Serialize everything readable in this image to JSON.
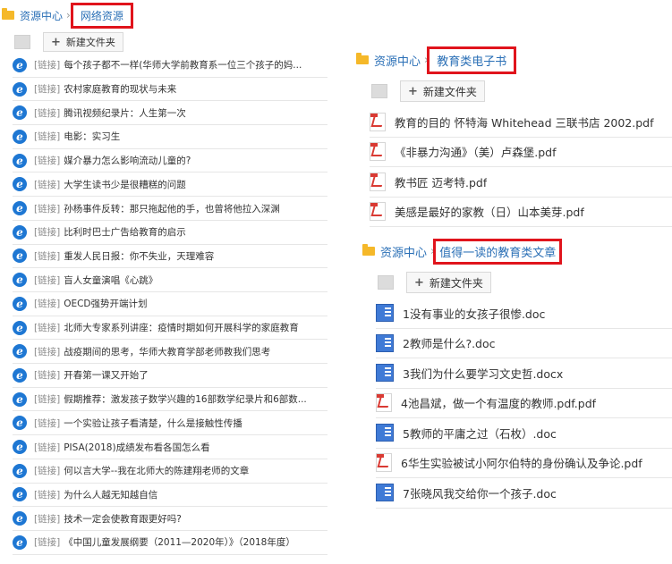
{
  "left": {
    "breadcrumb": [
      "资源中心",
      "网络资源"
    ],
    "new_folder": "新建文件夹",
    "tag": "[链接]",
    "items": [
      "每个孩子都不一样(华师大学前教育系一位三个孩子的妈...",
      "农村家庭教育的现状与未来",
      "腾讯视频纪录片：人生第一次",
      "电影：实习生",
      "媒介暴力怎么影响流动儿童的?",
      "大学生读书少是很糟糕的问题",
      "孙杨事件反转：那只拖起他的手，也曾将他拉入深渊",
      "比利时巴士广告给教育的启示",
      "重发人民日报：你不失业，天理难容",
      "盲人女童演唱《心跳》",
      "OECD强势开端计划",
      "北师大专家系列讲座：疫情时期如何开展科学的家庭教育",
      "战疫期间的思考，华师大教育学部老师教我们思考",
      "开春第一课又开始了",
      "假期推荐：激发孩子数学兴趣的16部数学纪录片和6部数...",
      "一个实验让孩子看清楚，什么是接触性传播",
      "PISA(2018)成绩发布看各国怎么看",
      "何以言大学--我在北师大的陈建翔老师的文章",
      "为什么人越无知越自信",
      "技术一定会使教育跟更好吗?",
      "《中国儿童发展纲要（2011—2020年）》（2018年度）"
    ]
  },
  "right1": {
    "breadcrumb": [
      "资源中心",
      "教育类电子书"
    ],
    "new_folder": "新建文件夹",
    "items": [
      "教育的目的 怀特海 Whitehead 三联书店 2002.pdf",
      "《非暴力沟通》（美）卢森堡.pdf",
      "教书匠 迈考特.pdf",
      "美感是最好的家教（日）山本美芽.pdf"
    ]
  },
  "right2": {
    "breadcrumb": [
      "资源中心",
      "值得一读的教育类文章"
    ],
    "new_folder": "新建文件夹",
    "items": [
      {
        "name": "1没有事业的女孩子很惨.doc",
        "type": "doc"
      },
      {
        "name": "2教师是什么?.doc",
        "type": "doc"
      },
      {
        "name": "3我们为什么要学习文史哲.docx",
        "type": "doc"
      },
      {
        "name": "4池昌斌，做一个有温度的教师.pdf.pdf",
        "type": "pdf"
      },
      {
        "name": "5教师的平庸之过（石枚）.doc",
        "type": "doc"
      },
      {
        "name": "6华生实验被试小阿尔伯特的身份确认及争论.pdf",
        "type": "pdf"
      },
      {
        "name": "7张晓风我交给你一个孩子.doc",
        "type": "doc"
      }
    ]
  },
  "colors": {
    "link_blue": "#2a6fb6",
    "highlight_red": "#e0141c",
    "folder_yellow": "#f5b829"
  }
}
